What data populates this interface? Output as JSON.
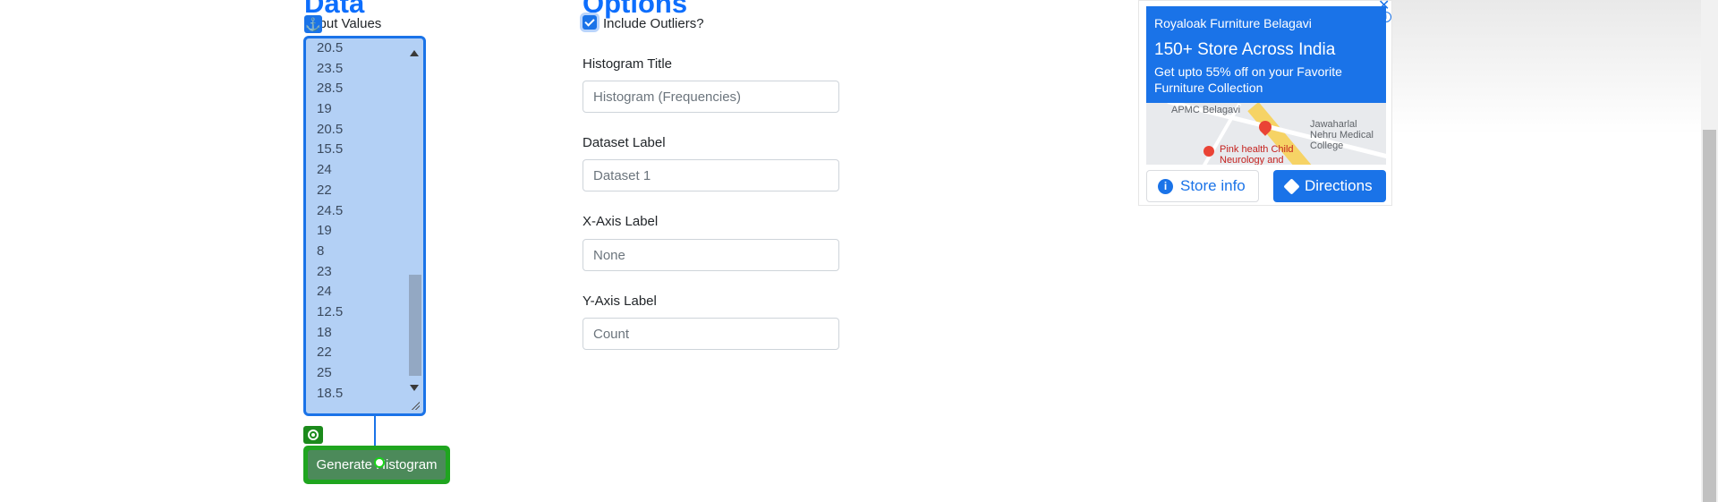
{
  "data_section": {
    "heading": "Data",
    "input_label": "Input Values",
    "values": [
      "20.5",
      "23.5",
      "28.5",
      "19",
      "20.5",
      "15.5",
      "24",
      "22",
      "24.5",
      "19",
      "8",
      "23",
      "24",
      "12.5",
      "18",
      "22",
      "25",
      "18.5"
    ],
    "generate_label": "Generate Histogram",
    "anchor_icon": "anchor-icon",
    "target_icon": "target-icon"
  },
  "options_section": {
    "heading": "Options",
    "include_outliers": {
      "label": "Include Outliers?",
      "checked": true
    },
    "fields": [
      {
        "label": "Histogram Title",
        "placeholder": "Histogram (Frequencies)",
        "value": ""
      },
      {
        "label": "Dataset Label",
        "placeholder": "Dataset 1",
        "value": ""
      },
      {
        "label": "X-Axis Label",
        "placeholder": "None",
        "value": ""
      },
      {
        "label": "Y-Axis Label",
        "placeholder": "Count",
        "value": ""
      }
    ]
  },
  "ad": {
    "brand": "Royaloak Furniture Belagavi",
    "headline": "150+ Store Across India",
    "description": "Get upto 55% off on your Favorite Furniture Collection",
    "map_labels": [
      "APMC Belagavi",
      "Jawaharlal Nehru Medical College",
      "Pink health Child Neurology and"
    ],
    "store_info_label": "Store info",
    "directions_label": "Directions",
    "accent_color": "#1a73e8"
  }
}
